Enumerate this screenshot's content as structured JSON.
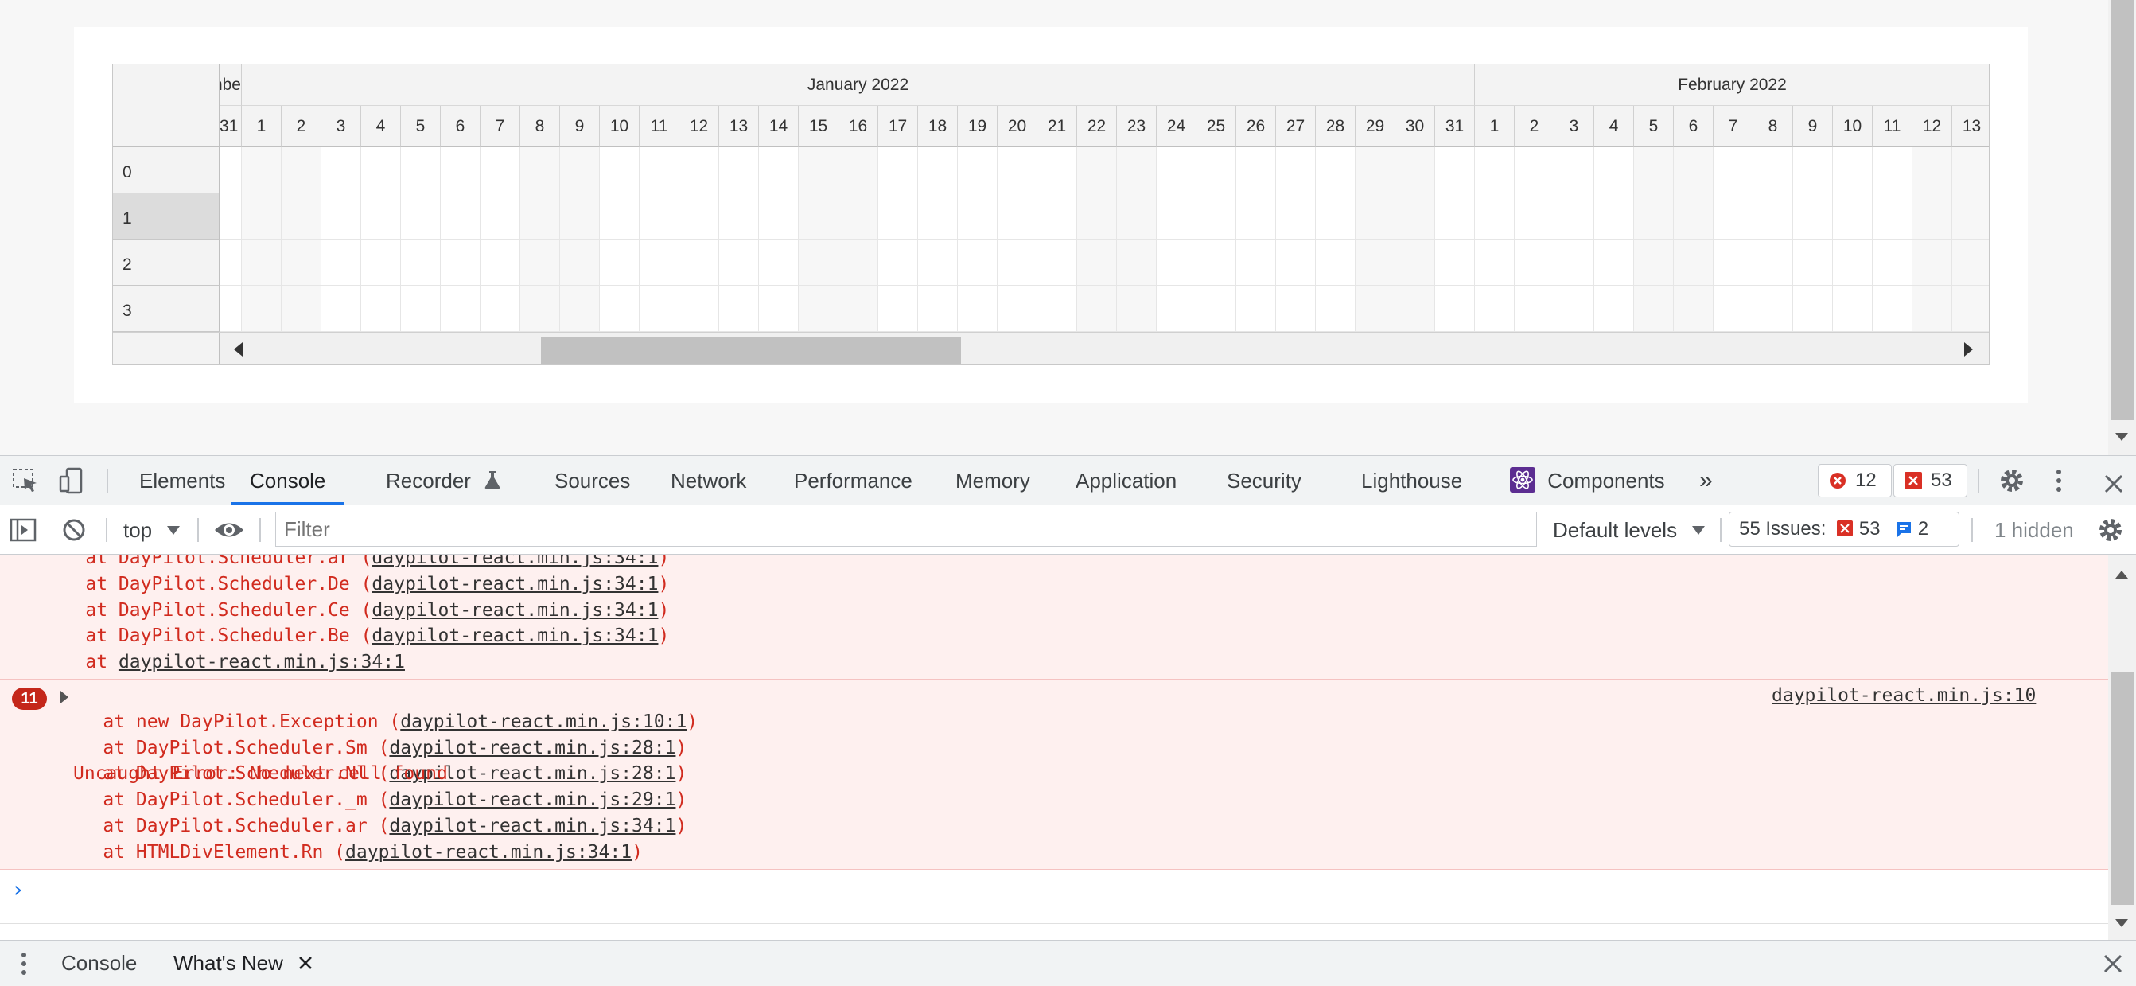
{
  "scheduler": {
    "months": [
      {
        "label": "nbe"
      },
      {
        "label": "January 2022"
      },
      {
        "label": "February 2022"
      }
    ],
    "days": [
      "31",
      "1",
      "2",
      "3",
      "4",
      "5",
      "6",
      "7",
      "8",
      "9",
      "10",
      "11",
      "12",
      "13",
      "14",
      "15",
      "16",
      "17",
      "18",
      "19",
      "20",
      "21",
      "22",
      "23",
      "24",
      "25",
      "26",
      "27",
      "28",
      "29",
      "30",
      "31",
      "1",
      "2",
      "3",
      "4",
      "5",
      "6",
      "7",
      "8",
      "9",
      "10",
      "11",
      "12",
      "13"
    ],
    "rows": [
      "0",
      "1",
      "2",
      "3"
    ],
    "selected_row": "1",
    "weekend_day_indexes": [
      1,
      2,
      8,
      9,
      15,
      16,
      22,
      23,
      29,
      30,
      36,
      37,
      43,
      44
    ]
  },
  "devtools": {
    "tabs": [
      {
        "label": "Elements"
      },
      {
        "label": "Console",
        "active": true
      },
      {
        "label": "Recorder"
      },
      {
        "label": "Sources"
      },
      {
        "label": "Network"
      },
      {
        "label": "Performance"
      },
      {
        "label": "Memory"
      },
      {
        "label": "Application"
      },
      {
        "label": "Security"
      },
      {
        "label": "Lighthouse"
      },
      {
        "label": "Components"
      }
    ],
    "more_tabs": "»",
    "error_count": "12",
    "warning_count": "53",
    "toolbar": {
      "context": "top",
      "filter_placeholder": "Filter",
      "levels": "Default levels",
      "issues_label": "55 Issues:",
      "issues_errors": "53",
      "issues_info": "2",
      "hidden": "1 hidden"
    },
    "console": {
      "error1_lines": [
        {
          "prefix": "    at DayPilot.Scheduler.ar (",
          "link": "daypilot-react.min.js:34:1",
          "suffix": ")"
        },
        {
          "prefix": "    at DayPilot.Scheduler.De (",
          "link": "daypilot-react.min.js:34:1",
          "suffix": ")"
        },
        {
          "prefix": "    at DayPilot.Scheduler.Ce (",
          "link": "daypilot-react.min.js:34:1",
          "suffix": ")"
        },
        {
          "prefix": "    at DayPilot.Scheduler.Be (",
          "link": "daypilot-react.min.js:34:1",
          "suffix": ")"
        },
        {
          "prefix": "    at ",
          "link": "daypilot-react.min.js:34:1",
          "suffix": ""
        }
      ],
      "error2": {
        "count": "11",
        "message": "Uncaught Error: No next cell found",
        "source": "daypilot-react.min.js:10",
        "lines": [
          {
            "prefix": "    at new DayPilot.Exception (",
            "link": "daypilot-react.min.js:10:1",
            "suffix": ")"
          },
          {
            "prefix": "    at DayPilot.Scheduler.Sm (",
            "link": "daypilot-react.min.js:28:1",
            "suffix": ")"
          },
          {
            "prefix": "    at DayPilot.Scheduler.Nl (",
            "link": "daypilot-react.min.js:28:1",
            "suffix": ")"
          },
          {
            "prefix": "    at DayPilot.Scheduler._m (",
            "link": "daypilot-react.min.js:29:1",
            "suffix": ")"
          },
          {
            "prefix": "    at DayPilot.Scheduler.ar (",
            "link": "daypilot-react.min.js:34:1",
            "suffix": ")"
          },
          {
            "prefix": "    at HTMLDivElement.Rn (",
            "link": "daypilot-react.min.js:34:1",
            "suffix": ")"
          }
        ]
      },
      "prompt": "›"
    },
    "drawer": {
      "tabs": [
        {
          "label": "Console"
        },
        {
          "label": "What's New",
          "active": true,
          "closable": true
        }
      ]
    }
  }
}
